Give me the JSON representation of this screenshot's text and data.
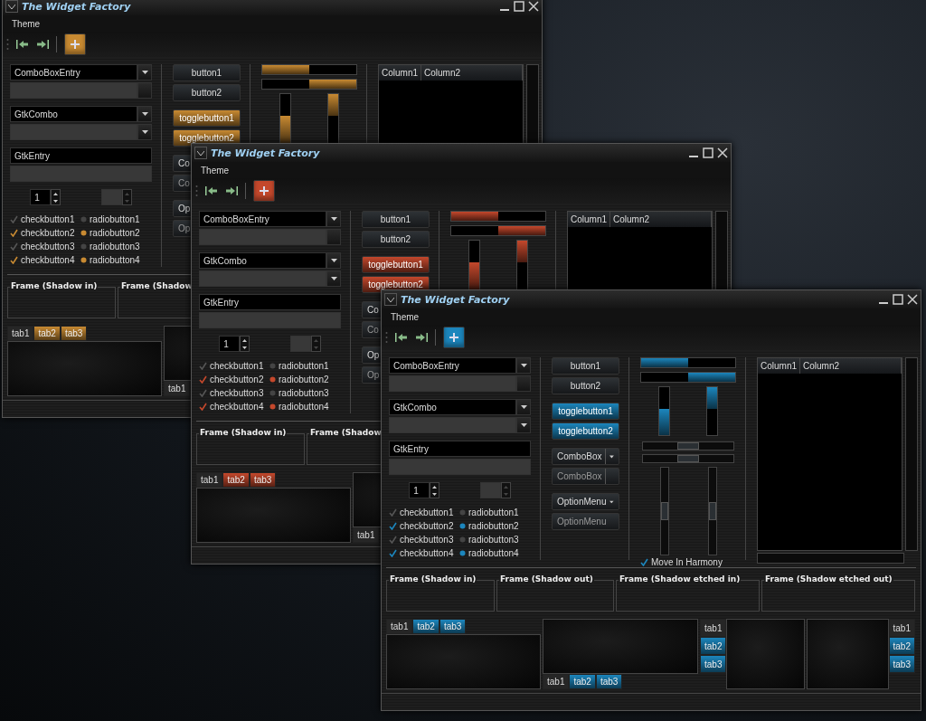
{
  "windows": [
    {
      "title": "The Widget Factory",
      "color": "#c88a32",
      "menu": [
        "Theme"
      ],
      "toolbar": {
        "add_active": true
      },
      "entries": [
        {
          "kind": "combo_entry",
          "value": "ComboBoxEntry",
          "disabled": false
        },
        {
          "kind": "combo_entry",
          "disabled": true
        },
        {
          "kind": "combo",
          "value": "GtkCombo",
          "disabled": false
        },
        {
          "kind": "combo",
          "disabled": true
        },
        {
          "kind": "entry",
          "value": "GtkEntry",
          "disabled": false
        },
        {
          "kind": "entry",
          "disabled": true
        }
      ],
      "spins": [
        {
          "value": "1",
          "disabled": false
        },
        {
          "disabled": true
        }
      ],
      "checks": [
        {
          "label": "checkbutton1",
          "checked": false
        },
        {
          "label": "checkbutton2",
          "checked": true
        },
        {
          "label": "checkbutton3",
          "checked": false
        },
        {
          "label": "checkbutton4",
          "checked": true
        }
      ],
      "radios": [
        {
          "label": "radiobutton1",
          "selected": false
        },
        {
          "label": "radiobutton2",
          "selected": true
        },
        {
          "label": "radiobutton3",
          "selected": false
        },
        {
          "label": "radiobutton4",
          "selected": true
        }
      ],
      "buttons": [
        {
          "kind": "button",
          "label": "button1"
        },
        {
          "kind": "button",
          "label": "button2"
        },
        {
          "kind": "toggle",
          "label": "togglebutton1",
          "active": true
        },
        {
          "kind": "toggle",
          "label": "togglebutton2",
          "active": true
        },
        {
          "kind": "combobox",
          "label": "Co",
          "disabled": false
        },
        {
          "kind": "combobox",
          "label": "Co",
          "disabled": true
        },
        {
          "kind": "optionmenu",
          "label": "Op",
          "disabled": false
        },
        {
          "kind": "optionmenu",
          "label": "Op",
          "disabled": true
        }
      ],
      "progress": [
        {
          "level": 0.5,
          "inverted": false
        },
        {
          "level": 0.5,
          "inverted": true
        }
      ],
      "vprogress": [
        {
          "level": 0.55,
          "inverted": false
        },
        {
          "level": 0.45,
          "inverted": true
        }
      ],
      "tree": {
        "columns": [
          "Column1",
          "Column2"
        ]
      },
      "frames": [
        "Frame (Shadow in)",
        "Frame (Shadow"
      ],
      "notebooks": [
        {
          "kind": "top",
          "tabs": [
            {
              "label": "tab1",
              "selected": true
            },
            {
              "label": "tab2",
              "selected": false
            },
            {
              "label": "tab3",
              "selected": false
            }
          ]
        },
        {
          "kind": "bottom",
          "tabs": [
            {
              "label": "tab1",
              "selected": true
            }
          ]
        }
      ]
    },
    {
      "title": "The Widget Factory",
      "color": "#c4482c",
      "menu": [
        "Theme"
      ],
      "toolbar": {
        "add_active": true
      },
      "entries": [
        {
          "kind": "combo_entry",
          "value": "ComboBoxEntry",
          "disabled": false
        },
        {
          "kind": "combo_entry",
          "disabled": true
        },
        {
          "kind": "combo",
          "value": "GtkCombo",
          "disabled": false
        },
        {
          "kind": "combo",
          "disabled": true
        },
        {
          "kind": "entry",
          "value": "GtkEntry",
          "disabled": false
        },
        {
          "kind": "entry",
          "disabled": true
        }
      ],
      "spins": [
        {
          "value": "1",
          "disabled": false
        },
        {
          "disabled": true
        }
      ],
      "checks": [
        {
          "label": "checkbutton1",
          "checked": false
        },
        {
          "label": "checkbutton2",
          "checked": true
        },
        {
          "label": "checkbutton3",
          "checked": false
        },
        {
          "label": "checkbutton4",
          "checked": true
        }
      ],
      "radios": [
        {
          "label": "radiobutton1",
          "selected": false
        },
        {
          "label": "radiobutton2",
          "selected": true
        },
        {
          "label": "radiobutton3",
          "selected": false
        },
        {
          "label": "radiobutton4",
          "selected": true
        }
      ],
      "buttons": [
        {
          "kind": "button",
          "label": "button1"
        },
        {
          "kind": "button",
          "label": "button2"
        },
        {
          "kind": "toggle",
          "label": "togglebutton1",
          "active": true
        },
        {
          "kind": "toggle",
          "label": "togglebutton2",
          "active": true
        },
        {
          "kind": "combobox",
          "label": "Co",
          "disabled": false
        },
        {
          "kind": "combobox",
          "label": "Co",
          "disabled": true
        },
        {
          "kind": "optionmenu",
          "label": "Op",
          "disabled": false
        },
        {
          "kind": "optionmenu",
          "label": "Op",
          "disabled": true
        }
      ],
      "progress": [
        {
          "level": 0.5,
          "inverted": false
        },
        {
          "level": 0.5,
          "inverted": true
        }
      ],
      "vprogress": [
        {
          "level": 0.55,
          "inverted": false
        },
        {
          "level": 0.45,
          "inverted": true
        }
      ],
      "tree": {
        "columns": [
          "Column1",
          "Column2"
        ]
      },
      "frames": [
        "Frame (Shadow in)",
        "Frame (Shadow"
      ],
      "notebooks": [
        {
          "kind": "top",
          "tabs": [
            {
              "label": "tab1",
              "selected": true
            },
            {
              "label": "tab2",
              "selected": false
            },
            {
              "label": "tab3",
              "selected": false
            }
          ]
        },
        {
          "kind": "bottom",
          "tabs": [
            {
              "label": "tab1",
              "selected": true
            }
          ]
        }
      ]
    },
    {
      "title": "The Widget Factory",
      "color": "#1c86bd",
      "menu": [
        "Theme"
      ],
      "toolbar": {
        "add_active": true
      },
      "entries": [
        {
          "kind": "combo_entry",
          "value": "ComboBoxEntry",
          "disabled": false
        },
        {
          "kind": "combo_entry",
          "disabled": true
        },
        {
          "kind": "combo",
          "value": "GtkCombo",
          "disabled": false
        },
        {
          "kind": "combo",
          "disabled": true
        },
        {
          "kind": "entry",
          "value": "GtkEntry",
          "disabled": false
        },
        {
          "kind": "entry",
          "disabled": true
        }
      ],
      "spins": [
        {
          "value": "1",
          "disabled": false
        },
        {
          "disabled": true
        }
      ],
      "checks": [
        {
          "label": "checkbutton1",
          "checked": false
        },
        {
          "label": "checkbutton2",
          "checked": true
        },
        {
          "label": "checkbutton3",
          "checked": false
        },
        {
          "label": "checkbutton4",
          "checked": true
        }
      ],
      "radios": [
        {
          "label": "radiobutton1",
          "selected": false
        },
        {
          "label": "radiobutton2",
          "selected": true
        },
        {
          "label": "radiobutton3",
          "selected": false
        },
        {
          "label": "radiobutton4",
          "selected": true
        }
      ],
      "buttons": [
        {
          "kind": "button",
          "label": "button1"
        },
        {
          "kind": "button",
          "label": "button2"
        },
        {
          "kind": "toggle",
          "label": "togglebutton1",
          "active": true
        },
        {
          "kind": "toggle",
          "label": "togglebutton2",
          "active": true
        },
        {
          "kind": "combobox",
          "label": "ComboBox",
          "disabled": false
        },
        {
          "kind": "combobox",
          "label": "ComboBox",
          "disabled": true
        },
        {
          "kind": "optionmenu",
          "label": "OptionMenu",
          "disabled": false
        },
        {
          "kind": "optionmenu",
          "label": "OptionMenu",
          "disabled": true
        }
      ],
      "progress": [
        {
          "level": 0.5,
          "inverted": false
        },
        {
          "level": 0.5,
          "inverted": true
        }
      ],
      "vprogress": [
        {
          "level": 0.55,
          "inverted": false
        },
        {
          "level": 0.45,
          "inverted": true
        }
      ],
      "hscales": [
        {
          "level": 0.5
        },
        {
          "level": 0.5
        }
      ],
      "vscales": [
        {
          "level": 0.5
        },
        {
          "level": 0.5
        }
      ],
      "harmony": {
        "label": "Move In Harmony",
        "checked": true
      },
      "tree": {
        "columns": [
          "Column1",
          "Column2"
        ]
      },
      "frames": [
        "Frame (Shadow in)",
        "Frame (Shadow out)",
        "Frame (Shadow etched in)",
        "Frame (Shadow etched out)"
      ],
      "notebooks": [
        {
          "kind": "top",
          "tabs": [
            {
              "label": "tab1",
              "selected": true
            },
            {
              "label": "tab2",
              "selected": false
            },
            {
              "label": "tab3",
              "selected": false
            }
          ]
        },
        {
          "kind": "bottom",
          "tabs": [
            {
              "label": "tab1",
              "selected": true
            },
            {
              "label": "tab2",
              "selected": false
            },
            {
              "label": "tab3",
              "selected": false
            }
          ]
        },
        {
          "kind": "left",
          "tabs": [
            {
              "label": "tab1",
              "selected": true
            },
            {
              "label": "tab2",
              "selected": false
            },
            {
              "label": "tab3",
              "selected": false
            }
          ]
        },
        {
          "kind": "right",
          "tabs": [
            {
              "label": "tab1",
              "selected": true
            },
            {
              "label": "tab2",
              "selected": false
            },
            {
              "label": "tab3",
              "selected": false
            }
          ]
        }
      ]
    }
  ]
}
